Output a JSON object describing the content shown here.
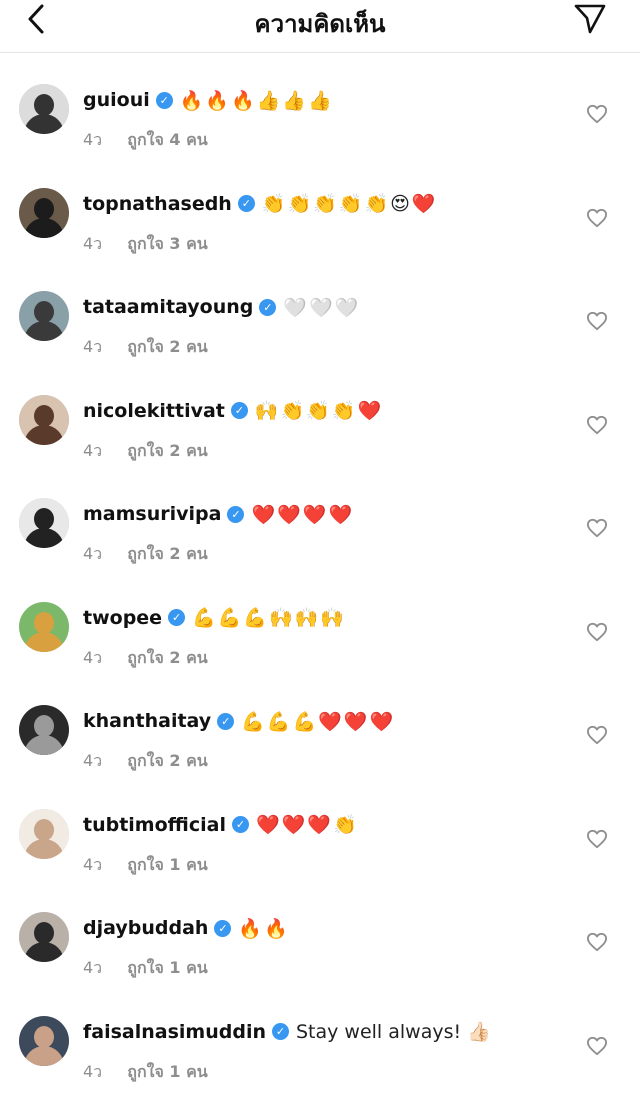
{
  "header": {
    "title": "ความคิดเห็น"
  },
  "comments": [
    {
      "username": "guioui",
      "text": "🔥🔥🔥👍👍👍",
      "time": "4ว",
      "likes": "ถูกใจ 4 คน",
      "avatar_color": "#dcdcdc",
      "avatar_fg": "#333333"
    },
    {
      "username": "topnathasedh",
      "text": "👏👏👏👏👏😍❤️",
      "time": "4ว",
      "likes": "ถูกใจ 3 คน",
      "avatar_color": "#6a5a4a",
      "avatar_fg": "#1c1c1c"
    },
    {
      "username": "tataamitayoung",
      "text": "🤍🤍🤍",
      "time": "4ว",
      "likes": "ถูกใจ 2 คน",
      "avatar_color": "#8aa0a8",
      "avatar_fg": "#3a3a3a"
    },
    {
      "username": "nicolekittivat",
      "text": "🙌👏👏👏❤️",
      "time": "4ว",
      "likes": "ถูกใจ 2 คน",
      "avatar_color": "#d8c2b0",
      "avatar_fg": "#5a3a2a"
    },
    {
      "username": "mamsurivipa",
      "text": "❤️❤️❤️❤️",
      "time": "4ว",
      "likes": "ถูกใจ 2 คน",
      "avatar_color": "#e8e8e8",
      "avatar_fg": "#222222"
    },
    {
      "username": "twopee",
      "text": "💪💪💪🙌🙌🙌",
      "time": "4ว",
      "likes": "ถูกใจ 2 คน",
      "avatar_color": "#7bb86a",
      "avatar_fg": "#d9a040"
    },
    {
      "username": "khanthaitay",
      "text": "💪💪💪❤️❤️❤️",
      "time": "4ว",
      "likes": "ถูกใจ 2 คน",
      "avatar_color": "#2a2a2a",
      "avatar_fg": "#9a9a9a"
    },
    {
      "username": "tubtimofficial",
      "text": "❤️❤️❤️👏",
      "time": "4ว",
      "likes": "ถูกใจ 1 คน",
      "avatar_color": "#f1ebe4",
      "avatar_fg": "#c9a58a"
    },
    {
      "username": "djaybuddah",
      "text": "🔥🔥",
      "time": "4ว",
      "likes": "ถูกใจ 1 คน",
      "avatar_color": "#b9b0a8",
      "avatar_fg": "#2a2a2a"
    },
    {
      "username": "faisalnasimuddin",
      "text": "Stay well always! 👍🏻",
      "time": "4ว",
      "likes": "ถูกใจ 1 คน",
      "avatar_color": "#3c4a5c",
      "avatar_fg": "#c9a088"
    }
  ]
}
